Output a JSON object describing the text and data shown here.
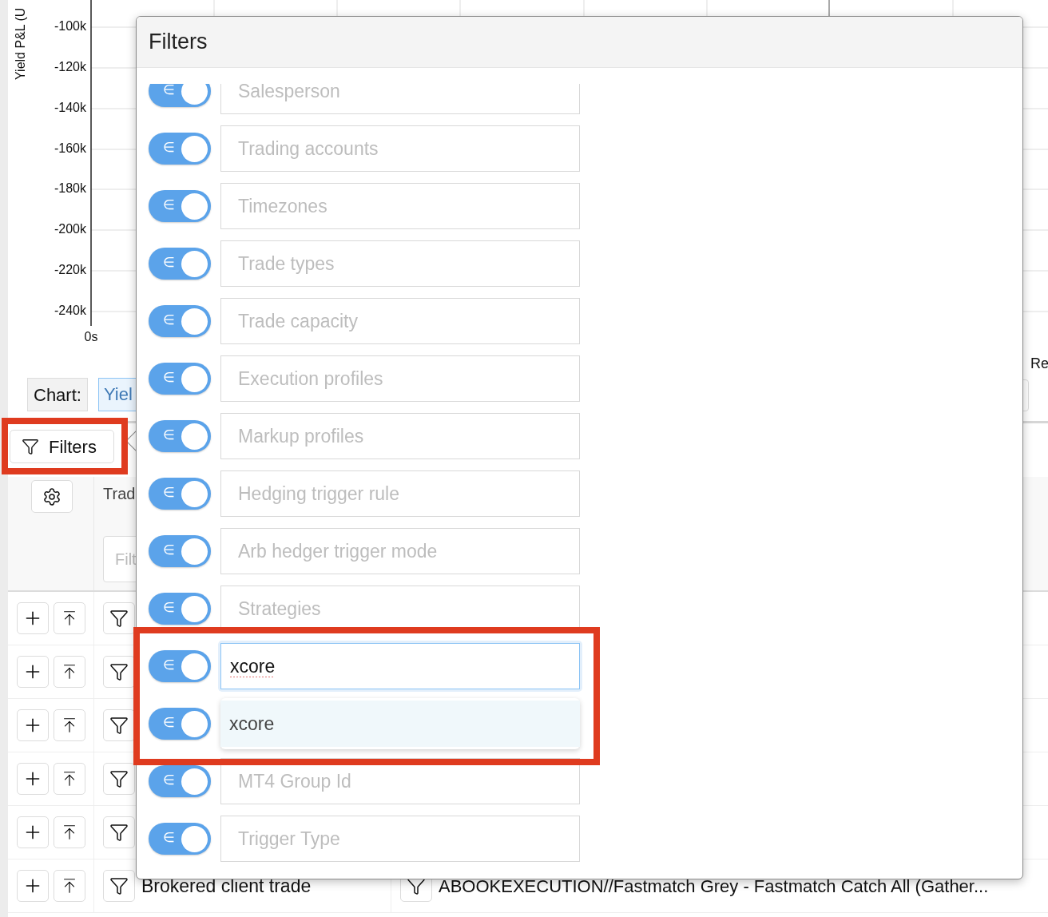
{
  "chart": {
    "ylabel": "Yield P&L (U",
    "yticks": [
      "-100k",
      "-120k",
      "-140k",
      "-160k",
      "-180k",
      "-200k",
      "-220k",
      "-240k"
    ],
    "xticks": [
      "0s"
    ]
  },
  "chart_controls": {
    "label": "Chart:",
    "value": "Yiel",
    "right_label": "Re"
  },
  "filters_button": {
    "label": "Filters"
  },
  "table": {
    "header": {
      "column_1": "Trad",
      "filter_placeholder": "Filt"
    },
    "rows": [
      {
        "kind": "covered"
      },
      {
        "kind": "covered"
      },
      {
        "kind": "covered"
      },
      {
        "kind": "covered"
      },
      {
        "kind": "covered"
      },
      {
        "kind": "visible",
        "trade_type": "Brokered client trade",
        "route": "ABOOKEXECUTION//Fastmatch Grey - Fastmatch Catch All (Gather..."
      }
    ]
  },
  "filters_panel": {
    "title": "Filters",
    "filters": [
      {
        "symbol": "∈",
        "on": true,
        "placeholder": "Salesperson"
      },
      {
        "symbol": "∈",
        "on": true,
        "placeholder": "Trading accounts"
      },
      {
        "symbol": "∈",
        "on": true,
        "placeholder": "Timezones"
      },
      {
        "symbol": "∈",
        "on": true,
        "placeholder": "Trade types"
      },
      {
        "symbol": "∈",
        "on": true,
        "placeholder": "Trade capacity"
      },
      {
        "symbol": "∈",
        "on": true,
        "placeholder": "Execution profiles"
      },
      {
        "symbol": "∈",
        "on": true,
        "placeholder": "Markup profiles"
      },
      {
        "symbol": "∈",
        "on": true,
        "placeholder": "Hedging trigger rule"
      },
      {
        "symbol": "∈",
        "on": true,
        "placeholder": "Arb hedger trigger mode"
      },
      {
        "symbol": "∈",
        "on": true,
        "placeholder": "Strategies"
      },
      {
        "symbol": "∈",
        "on": true,
        "value": "xcore"
      },
      {
        "symbol": "∈",
        "on": true
      },
      {
        "symbol": "∈",
        "on": true,
        "placeholder": "MT4 Group Id"
      },
      {
        "symbol": "∈",
        "on": true,
        "placeholder": "Trigger Type"
      }
    ],
    "suggestions": [
      {
        "label": "xcore",
        "highlighted": true
      }
    ]
  }
}
